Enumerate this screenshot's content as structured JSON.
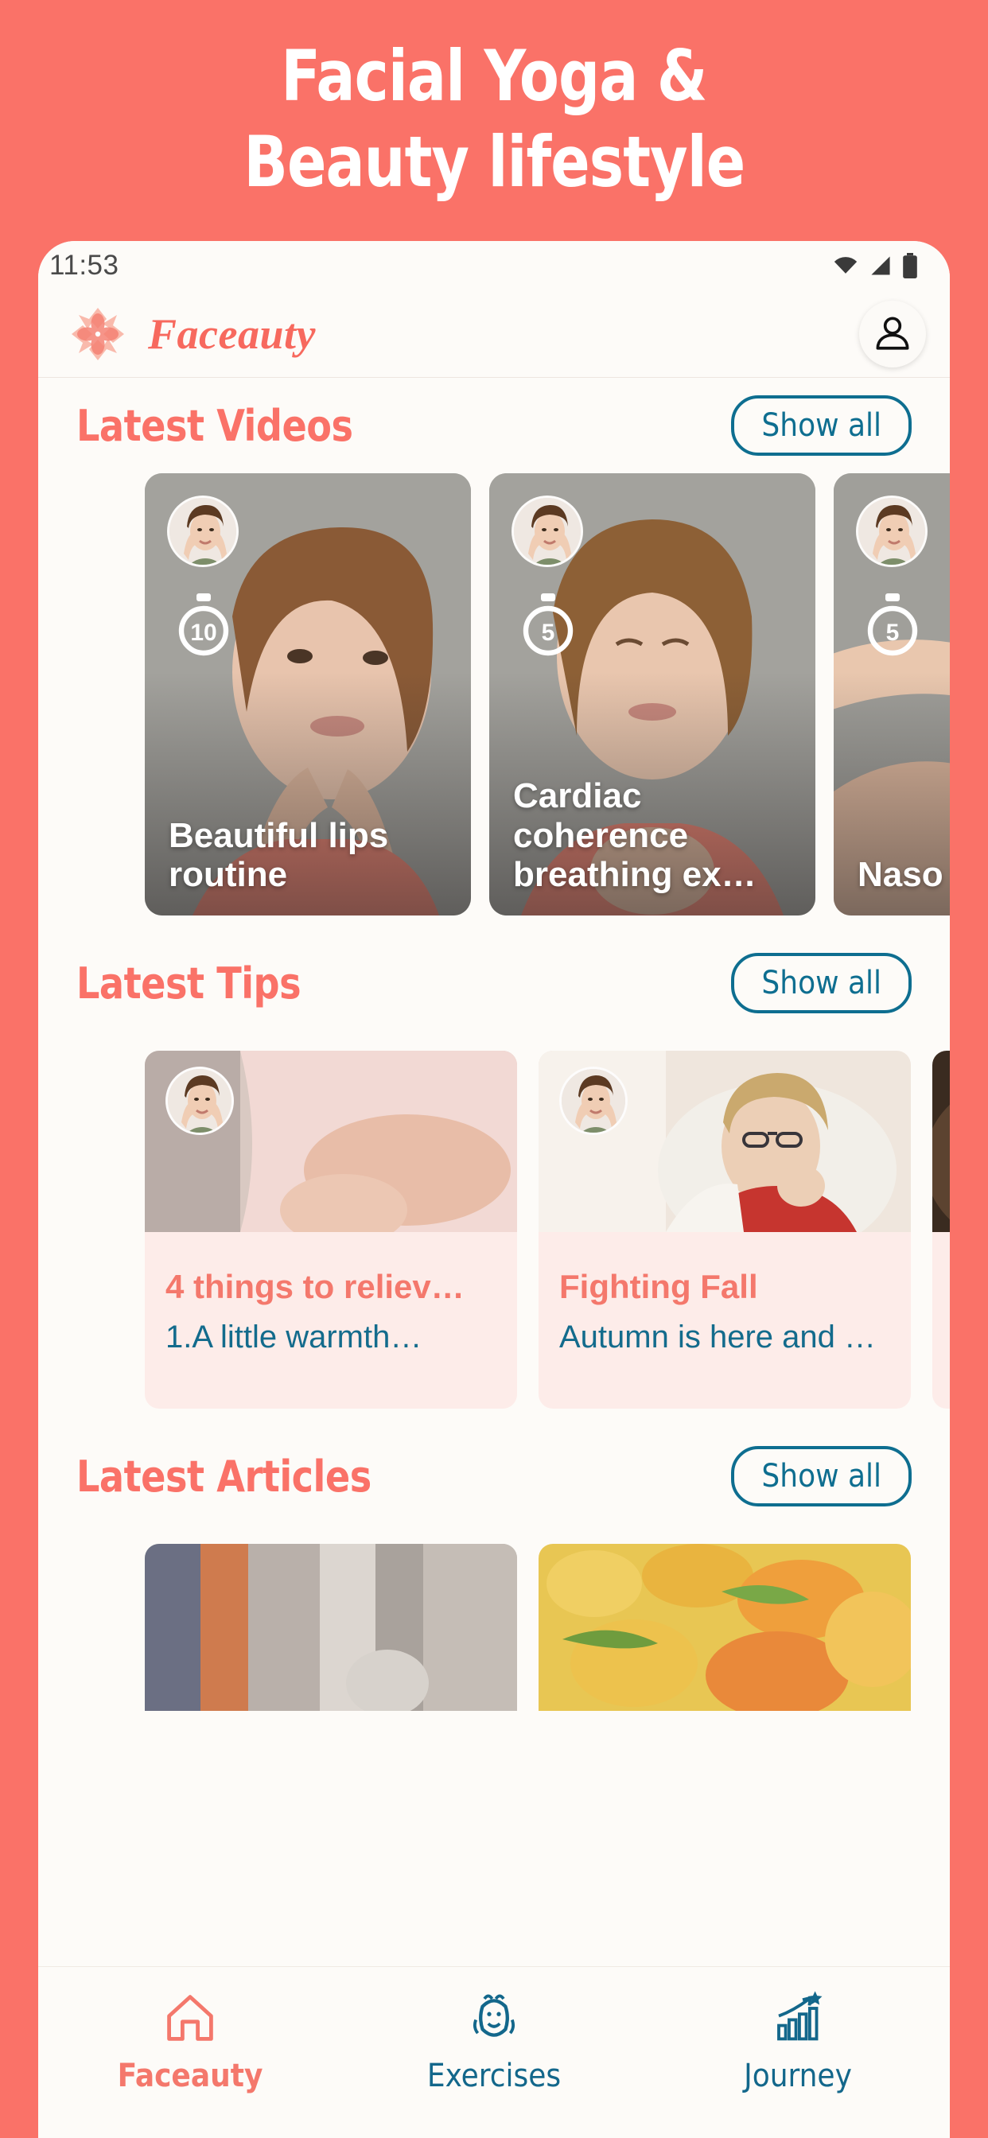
{
  "promo": {
    "line1": "Facial Yoga &",
    "line2": "Beauty lifestyle",
    "background_color": "#FA7268",
    "text_color": "#FFFFFF"
  },
  "theme": {
    "coral": "#FA7268",
    "coral_text": "#F4786C",
    "teal": "#0E6E90",
    "app_bg": "#FDFBF8",
    "tip_card_bg": "#FDECE9"
  },
  "status_bar": {
    "time": "11:53",
    "icons": [
      "wifi-icon",
      "signal-icon",
      "battery-icon"
    ]
  },
  "app_header": {
    "brand": "Faceauty",
    "logo_icon": "lotus-flower-icon",
    "avatar_icon": "person-icon"
  },
  "sections": [
    {
      "title": "Latest Videos",
      "show_all_label": "Show all"
    },
    {
      "title": "Latest Tips",
      "show_all_label": "Show all"
    },
    {
      "title": "Latest Articles",
      "show_all_label": "Show all"
    }
  ],
  "videos": [
    {
      "title": "Beautiful lips routine",
      "duration": "10",
      "timer_icon": "stopwatch-icon",
      "avatar_icon": "instructor-avatar"
    },
    {
      "title": "Cardiac coherence breathing ex…",
      "duration": "5",
      "timer_icon": "stopwatch-icon",
      "avatar_icon": "instructor-avatar"
    },
    {
      "title": "Naso folds",
      "duration": "5",
      "timer_icon": "stopwatch-icon",
      "avatar_icon": "instructor-avatar"
    }
  ],
  "tips": [
    {
      "title": "4 things to reliev…",
      "subtitle": "1.A little warmth…",
      "avatar_icon": "instructor-avatar"
    },
    {
      "title": "Fighting Fall",
      "subtitle": "Autumn is here and …",
      "avatar_icon": "instructor-avatar"
    },
    {
      "title": "",
      "subtitle": "",
      "avatar_icon": "instructor-avatar"
    }
  ],
  "bottom_nav": [
    {
      "label": "Faceauty",
      "icon": "home-icon",
      "active": true
    },
    {
      "label": "Exercises",
      "icon": "face-icon",
      "active": false
    },
    {
      "label": "Journey",
      "icon": "chart-star-icon",
      "active": false
    }
  ]
}
